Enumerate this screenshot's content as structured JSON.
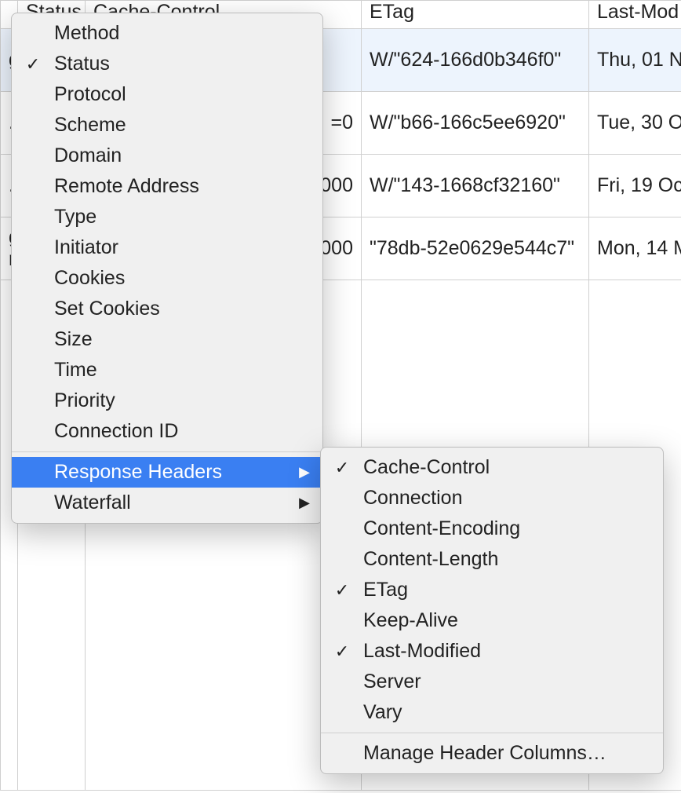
{
  "table": {
    "headers": {
      "status": "Status",
      "cache": "Cache-Control",
      "etag": "ETag",
      "last": "Last-Mod"
    },
    "rows": [
      {
        "name": "g",
        "cache": "",
        "etag": "W/\"624-166d0b346f0\"",
        "last": "Thu, 01 N"
      },
      {
        "name": ".js",
        "cache": "=0",
        "etag": "W/\"b66-166c5ee6920\"",
        "last": "Tue, 30 O"
      },
      {
        "name": ".c",
        "cache": "000",
        "etag": "W/\"143-1668cf32160\"",
        "last": "Fri, 19 Oc"
      },
      {
        "name": "g\nrg",
        "cache": "000",
        "etag": "\"78db-52e0629e544c7\"",
        "last": "Mon, 14 M"
      }
    ]
  },
  "menu": {
    "items": [
      {
        "label": "Method",
        "checked": false
      },
      {
        "label": "Status",
        "checked": true
      },
      {
        "label": "Protocol",
        "checked": false
      },
      {
        "label": "Scheme",
        "checked": false
      },
      {
        "label": "Domain",
        "checked": false
      },
      {
        "label": "Remote Address",
        "checked": false
      },
      {
        "label": "Type",
        "checked": false
      },
      {
        "label": "Initiator",
        "checked": false
      },
      {
        "label": "Cookies",
        "checked": false
      },
      {
        "label": "Set Cookies",
        "checked": false
      },
      {
        "label": "Size",
        "checked": false
      },
      {
        "label": "Time",
        "checked": false
      },
      {
        "label": "Priority",
        "checked": false
      },
      {
        "label": "Connection ID",
        "checked": false
      }
    ],
    "response_headers_label": "Response Headers",
    "waterfall_label": "Waterfall"
  },
  "submenu": {
    "items": [
      {
        "label": "Cache-Control",
        "checked": true
      },
      {
        "label": "Connection",
        "checked": false
      },
      {
        "label": "Content-Encoding",
        "checked": false
      },
      {
        "label": "Content-Length",
        "checked": false
      },
      {
        "label": "ETag",
        "checked": true
      },
      {
        "label": "Keep-Alive",
        "checked": false
      },
      {
        "label": "Last-Modified",
        "checked": true
      },
      {
        "label": "Server",
        "checked": false
      },
      {
        "label": "Vary",
        "checked": false
      }
    ],
    "manage_label": "Manage Header Columns…"
  },
  "glyphs": {
    "check": "✓",
    "arrow": "▶"
  }
}
